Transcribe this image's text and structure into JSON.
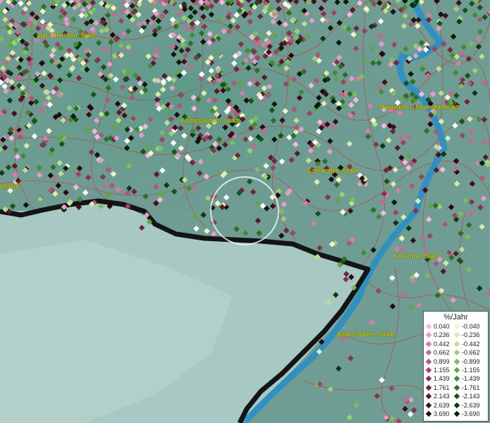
{
  "map": {
    "colors": {
      "background": "#6f9c93",
      "uplands": "#4f8f7f",
      "rhine_valley": "#a7c8c2",
      "river": "#2b8fc6",
      "border": "#141414",
      "admin_lines": "#d22b2b"
    },
    "places": [
      {
        "name": "Idar-Oberstein, Stadt"
      },
      {
        "name": "Kaiserslautern, Stadt"
      },
      {
        "name": "Mannheim, Universitätsstadt"
      },
      {
        "name": "Edenkoben, Stadt"
      },
      {
        "name": "ptstadt"
      },
      {
        "name": "Karlsruhe, Stadt"
      },
      {
        "name": "Baden-Baden, Stadt"
      }
    ],
    "highlight": {
      "name": "selection-circle"
    }
  },
  "legend": {
    "title": "%/Jahr",
    "positive": [
      {
        "label": "0.040",
        "color": "#f4b9e0"
      },
      {
        "label": "0.236",
        "color": "#e89ac8"
      },
      {
        "label": "0.442",
        "color": "#d57ea7"
      },
      {
        "label": "0.662",
        "color": "#c46a8d"
      },
      {
        "label": "0.899",
        "color": "#b05675"
      },
      {
        "label": "1.155",
        "color": "#9c4560"
      },
      {
        "label": "1.439",
        "color": "#87344c"
      },
      {
        "label": "1.761",
        "color": "#71253a"
      },
      {
        "label": "2.143",
        "color": "#5a1829"
      },
      {
        "label": "2.639",
        "color": "#420d1b"
      },
      {
        "label": "3.690",
        "color": "#2a040e"
      }
    ],
    "negative": [
      {
        "label": "-0.040",
        "color": "#f3f5c5"
      },
      {
        "label": "-0.236",
        "color": "#d9ecad"
      },
      {
        "label": "-0.442",
        "color": "#bce08e"
      },
      {
        "label": "-0.662",
        "color": "#9dcf72"
      },
      {
        "label": "-0.899",
        "color": "#7dbd5b"
      },
      {
        "label": "-1.155",
        "color": "#5ea646"
      },
      {
        "label": "-1.439",
        "color": "#438c34"
      },
      {
        "label": "-1.761",
        "color": "#2b7025"
      },
      {
        "label": "-2.143",
        "color": "#165418"
      },
      {
        "label": "-2.639",
        "color": "#0a3a0d"
      },
      {
        "label": "-3.690",
        "color": "#031c05"
      }
    ]
  }
}
